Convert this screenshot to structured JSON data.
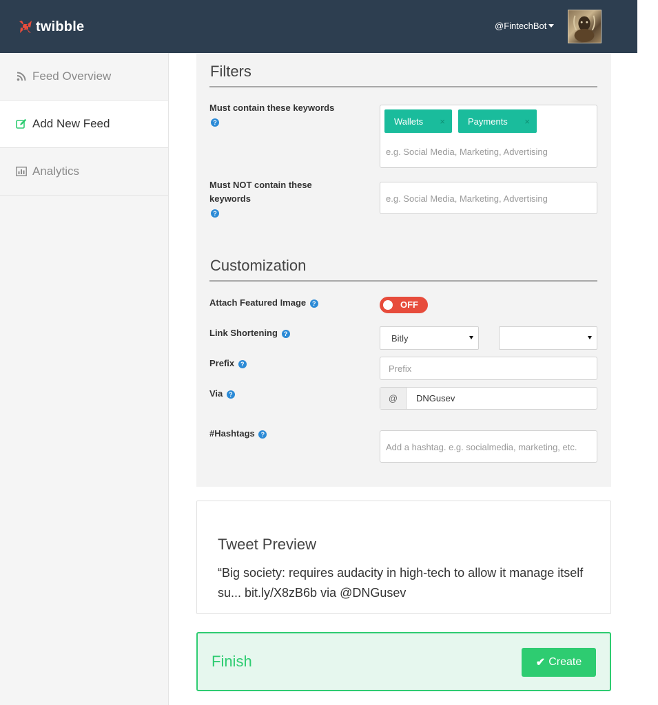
{
  "app": {
    "name": "twibble"
  },
  "header": {
    "username": "@FintechBot"
  },
  "sidebar": {
    "items": [
      {
        "label": "Feed Overview",
        "icon": "rss-icon"
      },
      {
        "label": "Add New Feed",
        "icon": "edit-icon"
      },
      {
        "label": "Analytics",
        "icon": "bar-chart-icon"
      }
    ]
  },
  "filters": {
    "title": "Filters",
    "must_contain": {
      "label": "Must contain these keywords",
      "tags": [
        "Wallets",
        "Payments"
      ],
      "placeholder": "e.g. Social Media, Marketing, Advertising"
    },
    "must_not_contain": {
      "label_line1": "Must NOT contain these",
      "label_line2": "keywords",
      "placeholder": "e.g. Social Media, Marketing, Advertising"
    }
  },
  "customization": {
    "title": "Customization",
    "featured_image": {
      "label": "Attach Featured Image",
      "state": "OFF"
    },
    "link_shortening": {
      "label": "Link Shortening",
      "service": "Bitly",
      "account": ""
    },
    "prefix": {
      "label": "Prefix",
      "placeholder": "Prefix"
    },
    "via": {
      "label": "Via",
      "addon": "@",
      "value": "DNGusev"
    },
    "hashtags": {
      "label": "#Hashtags",
      "placeholder": "Add a hashtag. e.g. socialmedia, marketing, etc."
    }
  },
  "preview": {
    "title": "Tweet Preview",
    "text": "“Big society: requires audacity in high-tech to allow it manage itself su... bit.ly/X8zB6b via @DNGusev"
  },
  "finish": {
    "title": "Finish",
    "button": "Create"
  },
  "colors": {
    "topbar": "#2d3e50",
    "tag": "#1abc9c",
    "toggle_off": "#e74c3c",
    "success": "#2ecc71",
    "help": "#2b8ad6"
  }
}
